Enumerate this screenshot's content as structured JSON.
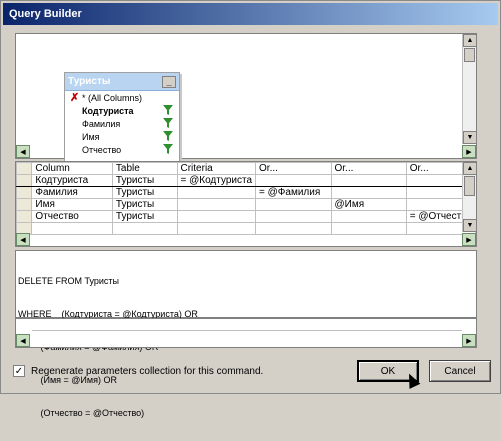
{
  "window": {
    "title": "Query Builder"
  },
  "diagram": {
    "table": {
      "name": "Туристы",
      "fields": [
        {
          "label": "* (All Columns)",
          "checked": true,
          "bold": false
        },
        {
          "label": "Кодтуриста",
          "checked": false,
          "bold": true,
          "filter": true
        },
        {
          "label": "Фамилия",
          "checked": false,
          "bold": false,
          "filter": true
        },
        {
          "label": "Имя",
          "checked": false,
          "bold": false,
          "filter": true
        },
        {
          "label": "Отчество",
          "checked": false,
          "bold": false,
          "filter": true
        }
      ]
    }
  },
  "grid": {
    "headers": [
      "Column",
      "Table",
      "Criteria",
      "Or...",
      "Or...",
      "Or..."
    ],
    "rows": [
      [
        "Кодтуриста",
        "Туристы",
        "= @Кодтуриста",
        "",
        "",
        ""
      ],
      [
        "Фамилия",
        "Туристы",
        "",
        "= @Фамилия",
        "",
        ""
      ],
      [
        "Имя",
        "Туристы",
        "",
        "",
        "@Имя",
        ""
      ],
      [
        "Отчество",
        "Туристы",
        "",
        "",
        "",
        "= @Отчество"
      ]
    ]
  },
  "sql": {
    "lines": [
      "DELETE FROM Туристы",
      "WHERE    (Кодтуриста = @Кодтуриста) OR",
      "         (Фамилия = @Фамилия) OR",
      "         (Имя = @Имя) OR",
      "         (Отчество = @Отчество)"
    ]
  },
  "options": {
    "regenerate_label": "Regenerate parameters collection for this command."
  },
  "buttons": {
    "ok": "OK",
    "cancel": "Cancel"
  },
  "colors": {
    "title_start": "#0a246a",
    "title_end": "#a6caf0",
    "accent_green": "#2f8f2f"
  }
}
